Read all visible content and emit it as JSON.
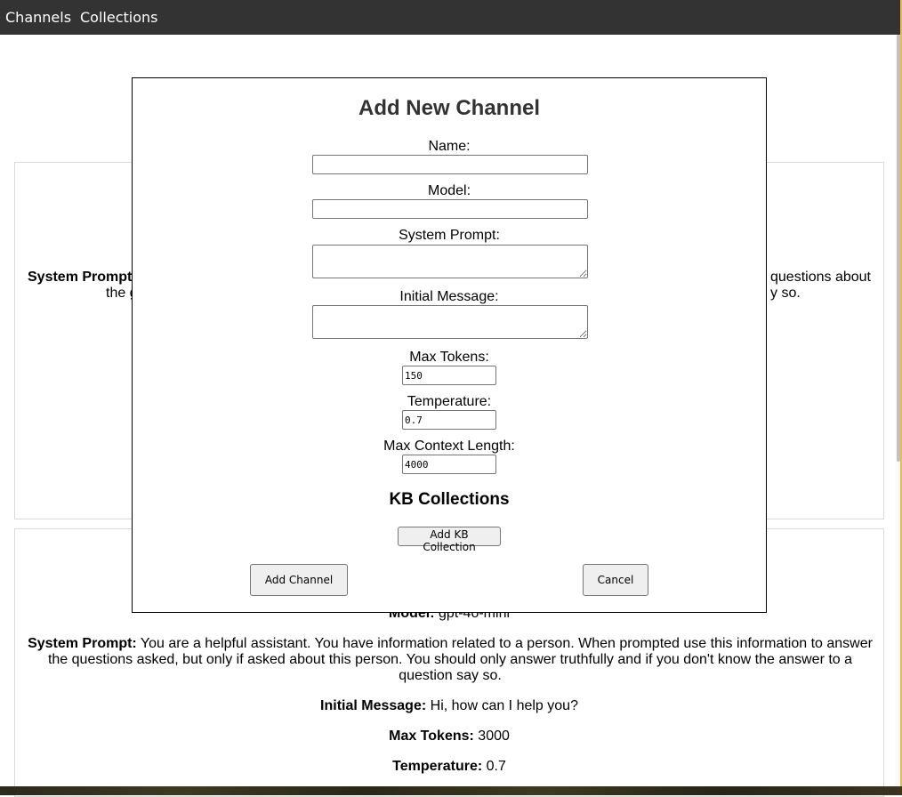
{
  "nav": {
    "channels": "Channels",
    "collections": "Collections"
  },
  "background": {
    "card1_left": "System Prompt",
    "card1_left_line2": "the g",
    "card1_right": "questions about",
    "card1_right_line2": "y so.",
    "card2": {
      "model_label": "Model:",
      "model_value": "gpt-4o-mini",
      "system_prompt_label": "System Prompt:",
      "system_prompt_value": "You are a helpful assistant. You have information related to a person. When prompted use this information to answer the questions asked, but only if asked about this person. You should only answer truthfully and if you don't know the answer to a question say so.",
      "initial_message_label": "Initial Message:",
      "initial_message_value": "Hi, how can I help you?",
      "max_tokens_label": "Max Tokens:",
      "max_tokens_value": "3000",
      "temperature_label": "Temperature:",
      "temperature_value": "0.7"
    }
  },
  "modal": {
    "title": "Add New Channel",
    "name_label": "Name:",
    "name_value": "",
    "model_label": "Model:",
    "model_value": "",
    "system_prompt_label": "System Prompt:",
    "system_prompt_value": "",
    "initial_message_label": "Initial Message:",
    "initial_message_value": "",
    "max_tokens_label": "Max Tokens:",
    "max_tokens_value": "150",
    "temperature_label": "Temperature:",
    "temperature_value": "0.7",
    "max_context_label": "Max Context Length:",
    "max_context_value": "4000",
    "kb_heading": "KB Collections",
    "add_kb_button": "Add KB Collection",
    "add_channel_button": "Add Channel",
    "cancel_button": "Cancel"
  }
}
